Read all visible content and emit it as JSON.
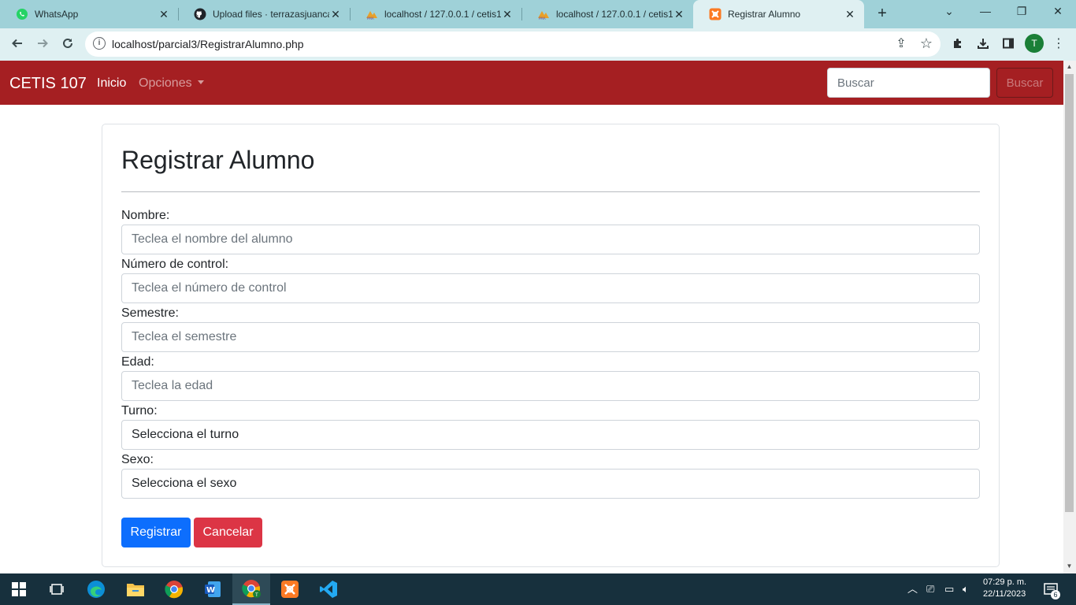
{
  "browser": {
    "tabs": [
      {
        "title": "WhatsApp",
        "icon": "whatsapp-icon"
      },
      {
        "title": "Upload files · terrazasjuanca",
        "icon": "github-icon"
      },
      {
        "title": "localhost / 127.0.0.1 / cetis1",
        "icon": "phpmyadmin-icon"
      },
      {
        "title": "localhost / 127.0.0.1 / cetis1",
        "icon": "phpmyadmin-icon"
      },
      {
        "title": "Registrar Alumno",
        "icon": "xampp-icon",
        "active": true
      }
    ],
    "url": "localhost/parcial3/RegistrarAlumno.php",
    "profile_initial": "T"
  },
  "navbar": {
    "brand": "CETIS 107",
    "inicio": "Inicio",
    "opciones": "Opciones",
    "search_placeholder": "Buscar",
    "search_button": "Buscar"
  },
  "form": {
    "title": "Registrar Alumno",
    "fields": [
      {
        "label": "Nombre:",
        "placeholder": "Teclea el nombre del alumno",
        "type": "input"
      },
      {
        "label": "Número de control:",
        "placeholder": "Teclea el número de control",
        "type": "input"
      },
      {
        "label": "Semestre:",
        "placeholder": "Teclea el semestre",
        "type": "input"
      },
      {
        "label": "Edad:",
        "placeholder": "Teclea la edad",
        "type": "input"
      },
      {
        "label": "Turno:",
        "value": "Selecciona el turno",
        "type": "select"
      },
      {
        "label": "Sexo:",
        "value": "Selecciona el sexo",
        "type": "select"
      }
    ],
    "submit_label": "Registrar",
    "cancel_label": "Cancelar"
  },
  "taskbar": {
    "time": "07:29 p. m.",
    "date": "22/11/2023",
    "notifications": "6"
  },
  "colors": {
    "navbar": "#a51f22",
    "primary": "#0d6efd",
    "danger": "#dc3545",
    "tabstrip": "#9fd1d8",
    "taskbar": "#17303d"
  }
}
